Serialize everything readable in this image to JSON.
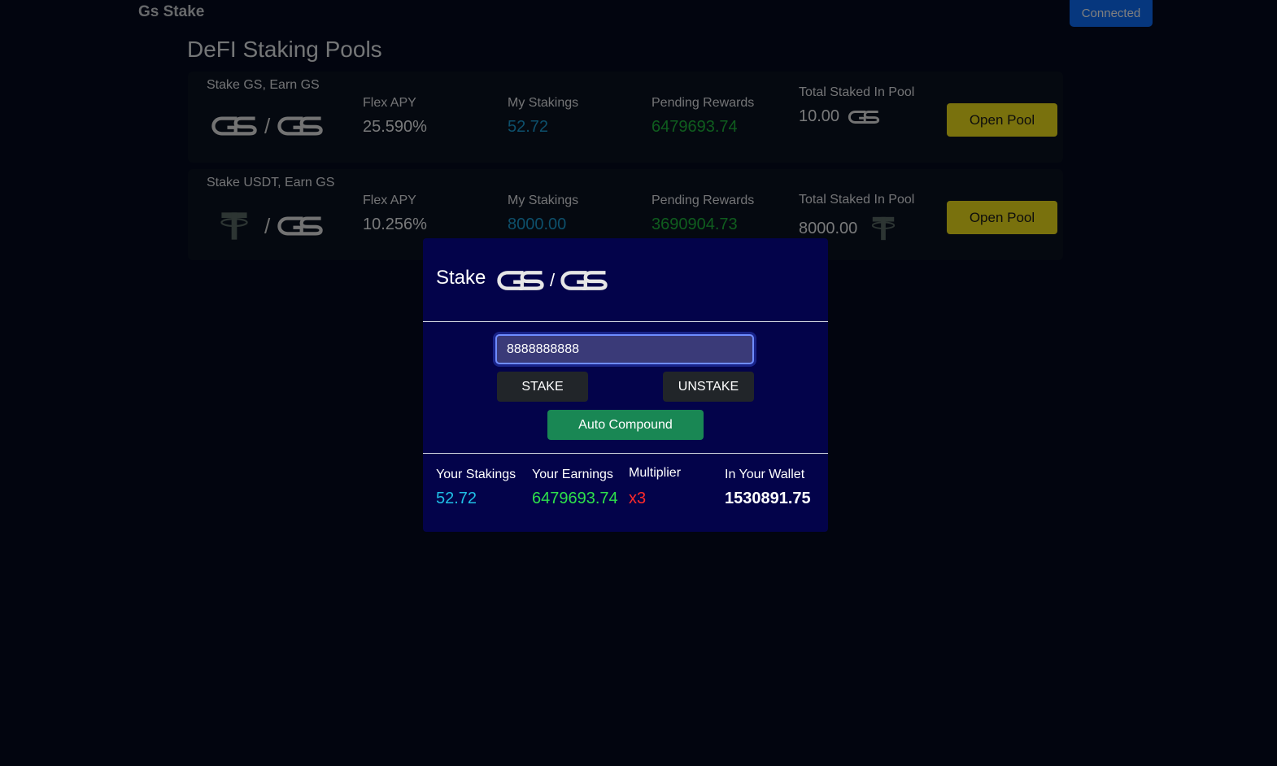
{
  "navbar": {
    "brand": "Gs Stake",
    "connect_label": "Connected"
  },
  "page": {
    "title": "DeFI Staking Pools"
  },
  "pools": [
    {
      "name": "Stake GS, Earn GS",
      "stake_token_icon": "gs-logo-icon",
      "earn_token_icon": "gs-logo-icon",
      "apy_label": "Flex APY",
      "apy": "25.590%",
      "stakings_label": "My Stakings",
      "stakings": "52.72",
      "rewards_label": "Pending Rewards",
      "rewards": "6479693.74",
      "total_label": "Total Staked In Pool",
      "total": "10.00",
      "total_icon": "gs-logo-icon",
      "button_label": "Open Pool"
    },
    {
      "name": "Stake USDT, Earn GS",
      "stake_token_icon": "tether-icon",
      "earn_token_icon": "gs-logo-icon",
      "apy_label": "Flex APY",
      "apy": "10.256%",
      "stakings_label": "My Stakings",
      "stakings": "8000.00",
      "rewards_label": "Pending Rewards",
      "rewards": "3690904.73",
      "total_label": "Total Staked In Pool",
      "total": "8000.00",
      "total_icon": "tether-icon",
      "button_label": "Open Pool"
    }
  ],
  "modal": {
    "title": "Stake",
    "amount_value": "8888888888",
    "stake_label": "STAKE",
    "unstake_label": "UNSTAKE",
    "auto_compound_label": "Auto Compound",
    "stats": {
      "stakings_label": "Your Stakings",
      "stakings": "52.72",
      "earnings_label": "Your Earnings",
      "earnings": "6479693.74",
      "multiplier_label": "Multiplier",
      "multiplier": "x3",
      "wallet_label": "In Your Wallet",
      "wallet": "1530891.75"
    }
  },
  "colors": {
    "background": "#050b1e",
    "connect_button": "#0d6efd",
    "open_pool_button": "#f3e21a",
    "modal_background": "#03034a",
    "auto_compound_button": "#198754",
    "stakings_value": "#1fc0e6",
    "earnings_value": "#2ee04a",
    "multiplier_value": "#ff2a2a"
  }
}
